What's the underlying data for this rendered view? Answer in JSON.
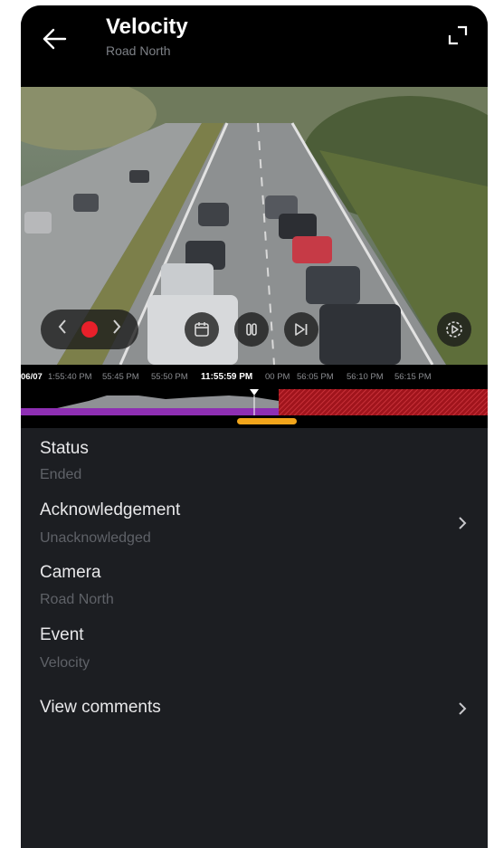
{
  "header": {
    "title": "Velocity",
    "subtitle": "Road North"
  },
  "timeline": {
    "date": "06/07",
    "labels_before": [
      "1:55:40 PM",
      "55:45 PM",
      "55:50 PM"
    ],
    "current_time": "11:55:59 PM",
    "labels_after": [
      "00 PM",
      "56:05 PM",
      "56:10 PM",
      "56:15 PM"
    ]
  },
  "details": {
    "status_label": "Status",
    "status_value": "Ended",
    "ack_label": "Acknowledgement",
    "ack_value": "Unacknowledged",
    "camera_label": "Camera",
    "camera_value": "Road North",
    "event_label": "Event",
    "event_value": "Velocity",
    "comments_label": "View comments"
  },
  "colors": {
    "recording_red": "#e8202a",
    "timeline_purple": "#8e2fb3",
    "timeline_red": "#c0202a",
    "scrub_orange": "#f2a51b",
    "panel_bg": "#1c1e22"
  },
  "icons": {
    "back": "arrow-left-icon",
    "expand": "expand-icon",
    "prev": "chevron-left-icon",
    "next": "chevron-right-icon",
    "record": "record-dot-icon",
    "calendar": "calendar-icon",
    "pause": "pause-icon",
    "skip_end": "skip-to-end-icon",
    "play_speed": "playback-speed-icon"
  }
}
